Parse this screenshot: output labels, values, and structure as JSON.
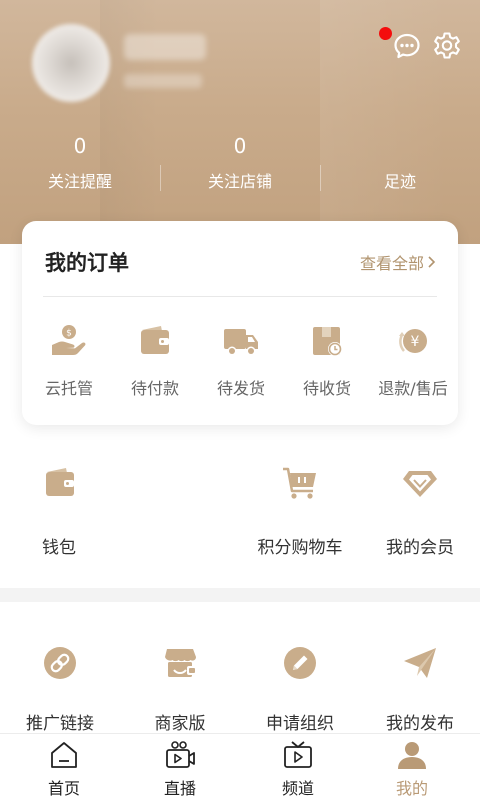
{
  "profile": {
    "stats": [
      {
        "value": "0",
        "label": "关注提醒"
      },
      {
        "value": "0",
        "label": "关注店铺"
      },
      {
        "value": "",
        "label": "足迹"
      }
    ]
  },
  "orders": {
    "title": "我的订单",
    "view_all": "查看全部",
    "items": [
      {
        "label": "云托管",
        "icon": "hand-coin-icon"
      },
      {
        "label": "待付款",
        "icon": "wallet-icon"
      },
      {
        "label": "待发货",
        "icon": "truck-icon"
      },
      {
        "label": "待收货",
        "icon": "package-clock-icon"
      },
      {
        "label": "退款/售后",
        "icon": "refund-yen-icon"
      }
    ]
  },
  "services_row1": [
    {
      "label": "钱包",
      "icon": "wallet-icon"
    },
    {
      "label": "积分购物车",
      "icon": "shopping-cart-icon"
    },
    {
      "label": "我的会员",
      "icon": "diamond-icon"
    }
  ],
  "services_row2": [
    {
      "label": "推广链接",
      "icon": "link-icon"
    },
    {
      "label": "商家版",
      "icon": "storefront-icon"
    },
    {
      "label": "申请组织",
      "icon": "pencil-icon"
    },
    {
      "label": "我的发布",
      "icon": "paper-plane-icon"
    }
  ],
  "tabs": [
    {
      "label": "首页",
      "icon": "home-icon"
    },
    {
      "label": "直播",
      "icon": "live-camera-icon"
    },
    {
      "label": "频道",
      "icon": "tv-play-icon"
    },
    {
      "label": "我的",
      "icon": "user-icon",
      "active": true
    }
  ],
  "colors": {
    "accent": "#b99a76",
    "header": "#c9ab8b",
    "icon_gold": "#c9ad8b",
    "badge": "#f40d0d"
  }
}
